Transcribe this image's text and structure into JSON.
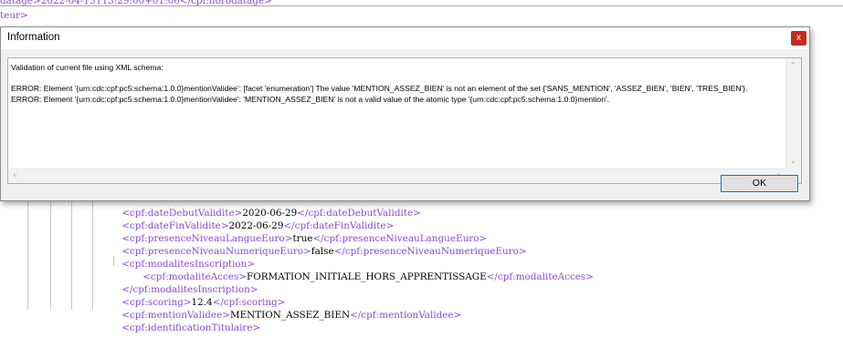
{
  "editor": {
    "header_lines": [
      "datage>2022-04-13T13:29:00+01:00</cpf:horodatage>",
      "teur>"
    ],
    "lines": [
      {
        "open": "<cpf:dateDebutValidite>",
        "value": "2020-06-29",
        "close": "</cpf:dateDebutValidite>"
      },
      {
        "open": "<cpf:dateFinValidite>",
        "value": "2022-06-29",
        "close": "</cpf:dateFinValidite>"
      },
      {
        "open": "<cpf:presenceNiveauLangueEuro>",
        "value": "true",
        "close": "</cpf:presenceNiveauLangueEuro>"
      },
      {
        "open": "<cpf:presenceNiveauNumeriqueEuro>",
        "value": "false",
        "close": "</cpf:presenceNiveauNumeriqueEuro>"
      },
      {
        "open": "<cpf:modalitesInscription>",
        "value": "",
        "close": ""
      },
      {
        "open": "<cpf:modaliteAcces>",
        "value": "FORMATION_INITIALE_HORS_APPRENTISSAGE",
        "close": "</cpf:modaliteAcces>"
      },
      {
        "open": "</cpf:modalitesInscription>",
        "value": "",
        "close": ""
      },
      {
        "open": "<cpf:scoring>",
        "value": "12.4",
        "close": "</cpf:scoring>"
      },
      {
        "open": "<cpf:mentionValidee>",
        "value": "MENTION_ASSEZ_BIEN",
        "close": "</cpf:mentionValidee>"
      },
      {
        "open": "<cpf:identificationTitulaire>",
        "value": "",
        "close": ""
      }
    ]
  },
  "dialog": {
    "title": "Information",
    "close_label": "x",
    "messages": [
      "Validation of current file using XML schema:",
      "",
      "ERROR: Element '{urn:cdc:cpf:pc5:schema:1.0.0}mentionValidee': [facet 'enumeration'] The value 'MENTION_ASSEZ_BIEN' is not an element of the set {'SANS_MENTION', 'ASSEZ_BIEN', 'BIEN', 'TRES_BIEN'}.",
      "ERROR: Element '{urn:cdc:cpf:pc5:schema:1.0.0}mentionValidee': 'MENTION_ASSEZ_BIEN' is not a valid value of the atomic type '{urn:cdc:cpf:pc5:schema:1.0.0}mention'."
    ],
    "ok_label": "OK"
  },
  "icons": {
    "scroll_up": "scroll-up-icon",
    "scroll_down": "scroll-down-icon",
    "scroll_left": "scroll-left-icon",
    "scroll_right": "scroll-right-icon"
  },
  "colors": {
    "tag": "#8a4ad0",
    "close_button": "#c42b1c",
    "ok_border": "#0078d7"
  }
}
